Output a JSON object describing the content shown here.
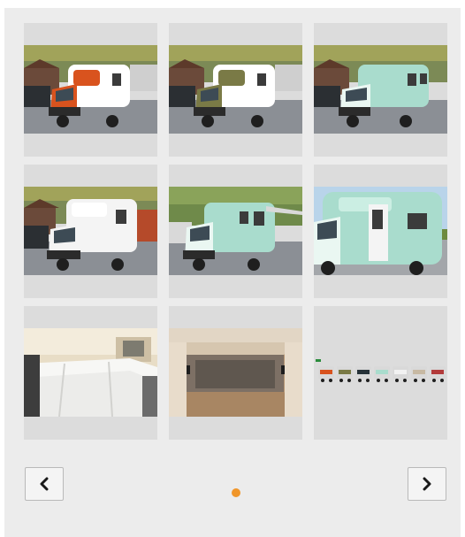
{
  "gallery": {
    "thumbnails": [
      {
        "name": "thumb-orange-camper",
        "icon": "camper-photo",
        "body": "#d9531e",
        "accent": "#ffffff"
      },
      {
        "name": "thumb-olive-camper",
        "icon": "camper-photo",
        "body": "#7a7a46",
        "accent": "#ffffff"
      },
      {
        "name": "thumb-mint-camper",
        "icon": "camper-photo",
        "body": "#a9dccd",
        "accent": "#ffffff"
      },
      {
        "name": "thumb-white-camper",
        "icon": "camper-photo",
        "body": "#f4f4f4",
        "accent": "#ffffff"
      },
      {
        "name": "thumb-mint-camper-awning",
        "icon": "camper-photo",
        "body": "#a9dccd",
        "accent": "#ffffff"
      },
      {
        "name": "thumb-mint-camper-closeup",
        "icon": "camper-photo",
        "body": "#a9dccd",
        "accent": "#ffffff"
      },
      {
        "name": "thumb-interior-bed",
        "icon": "interior-bed-photo"
      },
      {
        "name": "thumb-interior-loft",
        "icon": "interior-loft-photo"
      },
      {
        "name": "thumb-color-variants",
        "icon": "color-variants-photo",
        "variant_colors": [
          "#d9531e",
          "#7a7a46",
          "#263238",
          "#a9dccd",
          "#f2f2f2",
          "#c7b9a3",
          "#b23a3a"
        ]
      }
    ],
    "prev_icon": "chevron-left-icon",
    "next_icon": "chevron-right-icon",
    "pager": {
      "active_index": 1,
      "active_color": "#f0962a"
    }
  }
}
